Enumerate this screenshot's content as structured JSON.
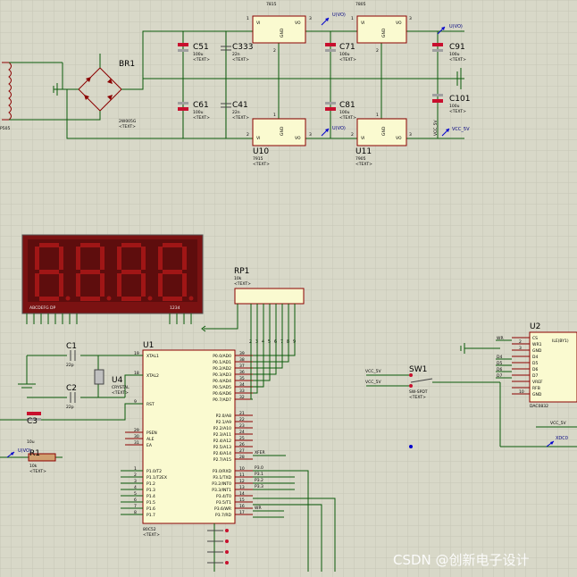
{
  "colors": {
    "background": "#d8d8c8",
    "grid": "#c8c8b8",
    "wire": "#0a5a0a",
    "body_stroke": "#8b0000",
    "body_fill": "#fafad0",
    "display_bg": "#7a1212",
    "digit_off": "#a01616",
    "probe": "#0000cc"
  },
  "regulators_top": [
    {
      "vi": "VI",
      "vo": "VO",
      "gnd": "GND",
      "pin_in": "1",
      "pin_out": "3",
      "pin_gnd": "2"
    },
    {
      "vi": "VI",
      "vo": "VO",
      "gnd": "GND",
      "pin_in": "1",
      "pin_out": "3",
      "pin_gnd": "2"
    }
  ],
  "regulators_bottom": [
    {
      "ref": "U10",
      "part": "7915",
      "text": "<TEXT>",
      "vi": "VI",
      "vo": "VO",
      "gnd": "GND",
      "pin_in": "2",
      "pin_out": "3",
      "pin_gnd": "1"
    },
    {
      "ref": "U11",
      "part": "7905",
      "text": "<TEXT>",
      "vi": "VI",
      "vo": "VO",
      "gnd": "GND",
      "pin_in": "2",
      "pin_out": "3",
      "pin_gnd": "1"
    }
  ],
  "capacitors": [
    {
      "ref": "C51",
      "value": "100u",
      "text": "<TEXT>"
    },
    {
      "ref": "C333",
      "value": "22n",
      "text": "<TEXT>"
    },
    {
      "ref": "C71",
      "value": "100u",
      "text": "<TEXT>"
    },
    {
      "ref": "C91",
      "value": "100u",
      "text": "<TEXT>"
    },
    {
      "ref": "C61",
      "value": "100u",
      "text": "<TEXT>"
    },
    {
      "ref": "C41",
      "value": "22n",
      "text": "<TEXT>"
    },
    {
      "ref": "C81",
      "value": "100u",
      "text": "<TEXT>"
    },
    {
      "ref": "C101",
      "value": "100u",
      "text": "<TEXT>"
    }
  ],
  "bridge": {
    "ref": "BR1",
    "part": "2W005G",
    "text": "<TEXT>"
  },
  "probes": {
    "p1": "U(VO)",
    "p2": "U(VO)",
    "p3": "U(VO)",
    "p4": "U(VO)",
    "vcc": "VCC_5V"
  },
  "rot_labels": {
    "vcc": "VCC_5V"
  },
  "display": {
    "seg_label": "ABCDEFG DP",
    "digit_label": "1234"
  },
  "rp1": {
    "ref": "RP1",
    "value": "10k",
    "text": "<TEXT>",
    "pins": [
      "2",
      "3",
      "4",
      "5",
      "6",
      "7",
      "8",
      "9"
    ]
  },
  "crystal": {
    "c1": "C1",
    "c1_value": "22p",
    "c2": "C2",
    "c2_value": "22p",
    "c3": "C3",
    "c3_value": "10u",
    "u4": "U4",
    "u4_desc": "CRYSTAL",
    "r1": "R1",
    "r1_value": "10k",
    "text": "<TEXT>"
  },
  "mcu": {
    "ref": "U1",
    "part": "80C52",
    "text": "<TEXT>",
    "left_pins": [
      {
        "pin": "19",
        "name": "XTAL1"
      },
      {
        "pin": "18",
        "name": "XTAL2"
      },
      {
        "pin": "9",
        "name": "RST"
      },
      {
        "pin": "29",
        "name": "PSEN"
      },
      {
        "pin": "30",
        "name": "ALE"
      },
      {
        "pin": "31",
        "name": "EA"
      },
      {
        "pin": "1",
        "name": "P1.0/T2"
      },
      {
        "pin": "2",
        "name": "P1.1/T2EX"
      },
      {
        "pin": "3",
        "name": "P1.2"
      },
      {
        "pin": "4",
        "name": "P1.3"
      },
      {
        "pin": "5",
        "name": "P1.4"
      },
      {
        "pin": "6",
        "name": "P1.5"
      },
      {
        "pin": "7",
        "name": "P1.6"
      },
      {
        "pin": "8",
        "name": "P1.7"
      }
    ],
    "right_pins": [
      {
        "pin": "39",
        "name": "P0.0/AD0"
      },
      {
        "pin": "38",
        "name": "P0.1/AD1"
      },
      {
        "pin": "37",
        "name": "P0.2/AD2"
      },
      {
        "pin": "36",
        "name": "P0.3/AD3"
      },
      {
        "pin": "35",
        "name": "P0.4/AD4"
      },
      {
        "pin": "34",
        "name": "P0.5/AD5"
      },
      {
        "pin": "33",
        "name": "P0.6/AD6"
      },
      {
        "pin": "32",
        "name": "P0.7/AD7"
      },
      {
        "pin": "21",
        "name": "P2.0/A8"
      },
      {
        "pin": "22",
        "name": "P2.1/A9"
      },
      {
        "pin": "23",
        "name": "P2.2/A10"
      },
      {
        "pin": "24",
        "name": "P2.3/A11"
      },
      {
        "pin": "25",
        "name": "P2.4/A12"
      },
      {
        "pin": "26",
        "name": "P2.5/A13"
      },
      {
        "pin": "27",
        "name": "P2.6/A14"
      },
      {
        "pin": "28",
        "name": "P2.7/A15"
      },
      {
        "pin": "10",
        "name": "P3.0/RXD"
      },
      {
        "pin": "11",
        "name": "P3.1/TXD"
      },
      {
        "pin": "12",
        "name": "P3.2/INT0"
      },
      {
        "pin": "13",
        "name": "P3.3/INT1"
      },
      {
        "pin": "14",
        "name": "P3.4/T0"
      },
      {
        "pin": "15",
        "name": "P3.5/T1"
      },
      {
        "pin": "16",
        "name": "P3.6/WR"
      },
      {
        "pin": "17",
        "name": "P3.7/RD"
      }
    ],
    "net_labels": [
      "XFER",
      "P3.0",
      "P3.1",
      "P3.2",
      "P3.3",
      "WR"
    ]
  },
  "switch": {
    "ref": "SW1",
    "part": "SW-SPDT",
    "text": "<TEXT>",
    "vcc1": "VCC_5V",
    "vcc2": "VCC_5V"
  },
  "u2": {
    "ref": "U2",
    "part": "DAC0832",
    "left_pins": [
      {
        "pin": "",
        "name": "CS"
      },
      {
        "pin": "2",
        "name": "WR1"
      },
      {
        "pin": "3",
        "name": "GND"
      },
      {
        "pin": "",
        "name": "D4"
      },
      {
        "pin": "",
        "name": "D5"
      },
      {
        "pin": "",
        "name": "D6"
      },
      {
        "pin": "",
        "name": "D7"
      },
      {
        "pin": "",
        "name": "VREF"
      },
      {
        "pin": "",
        "name": "RFB"
      },
      {
        "pin": "10",
        "name": "GND"
      }
    ],
    "side_labels": [
      "WR",
      "D4",
      "D5",
      "D6",
      "D7"
    ],
    "right_partial": "ILE(BY1)",
    "vcc": "VCC_5V",
    "xdcd": "XDC0"
  },
  "watermark": "CSDN @创新电子设计"
}
